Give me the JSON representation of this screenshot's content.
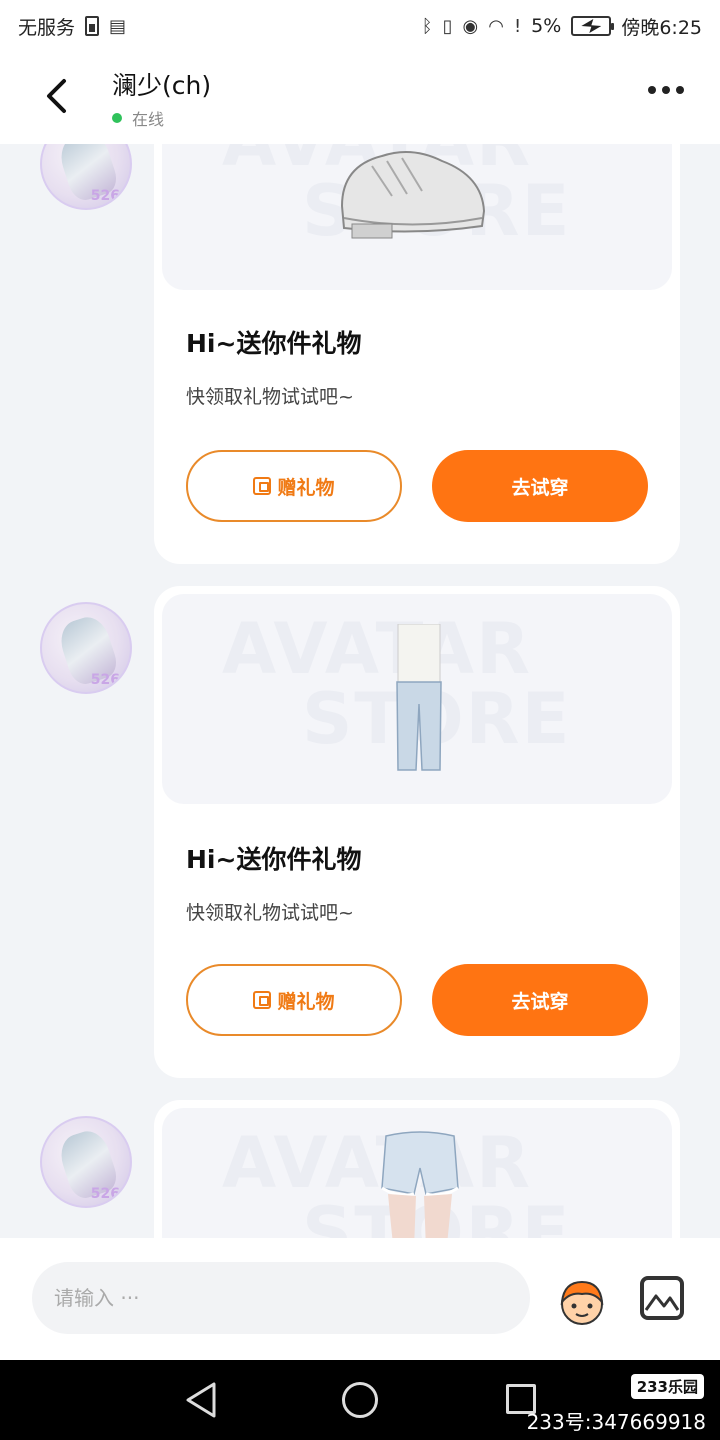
{
  "status_bar": {
    "left_text": "无服务",
    "battery_percent": "5%",
    "time": "傍晚6:25"
  },
  "header": {
    "title": "澜少(ch)",
    "status": "在线"
  },
  "messages": [
    {
      "avatar_badge": "526",
      "item": "shoe",
      "title": "Hi~送你件礼物",
      "subtitle": "快领取礼物试试吧~",
      "gift_label": "赠礼物",
      "try_label": "去试穿"
    },
    {
      "avatar_badge": "526",
      "item": "pants",
      "title": "Hi~送你件礼物",
      "subtitle": "快领取礼物试试吧~",
      "gift_label": "赠礼物",
      "try_label": "去试穿"
    },
    {
      "avatar_badge": "526",
      "item": "shorts"
    }
  ],
  "watermark": {
    "line1": "AVATAR",
    "line2": "STORE"
  },
  "input": {
    "placeholder": "请输入 ···"
  },
  "system_watermark": {
    "logo": "233乐园",
    "id": "233号:347669918"
  },
  "colors": {
    "accent": "#ff7412",
    "online": "#2fc25b"
  }
}
